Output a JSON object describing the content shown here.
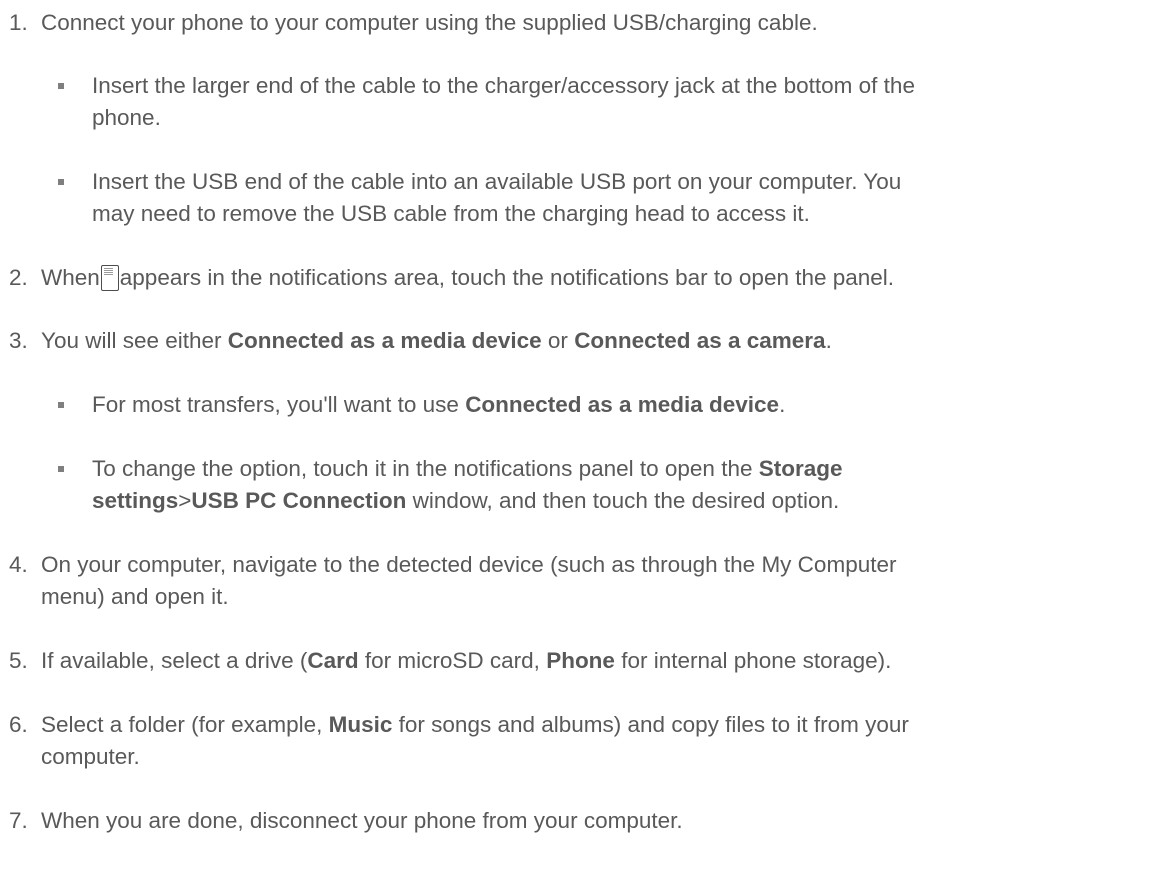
{
  "steps": [
    {
      "num": "1.",
      "text": "Connect your phone to your computer using the supplied USB/charging cable.",
      "subs": [
        {
          "line1": "Insert the larger end of the cable to the charger/accessory jack at the bottom of the",
          "line2": "phone."
        },
        {
          "line1": "Insert the USB end of the cable into an available USB port on your computer. You",
          "line2": "may need to remove the USB cable from the charging head to access it."
        }
      ]
    },
    {
      "num": "2.",
      "pre": "When",
      "icon": "usb-notification-icon",
      "post": "appears in the notifications area, touch the notifications bar to open the panel."
    },
    {
      "num": "3.",
      "a": "You will see either ",
      "b1": "Connected as a media device",
      "c": " or ",
      "b2": "Connected as a camera",
      "d": ".",
      "subs": [
        {
          "a": "For most transfers, you'll want to use ",
          "b": "Connected as a media device",
          "c": "."
        },
        {
          "a": "To change the option, touch it in the notifications panel to open the ",
          "b": "Storage",
          "b2": "settings",
          "sep": ">",
          "b3": "USB PC Connection",
          "c": " window, and then touch the desired option."
        }
      ]
    },
    {
      "num": "4.",
      "line1": "On your computer, navigate to the detected device (such as through the My Computer",
      "line2": "menu) and open it."
    },
    {
      "num": "5.",
      "a": "If available, select a drive (",
      "b1": "Card",
      "c": " for microSD card, ",
      "b2": "Phone",
      "d": " for internal phone storage)."
    },
    {
      "num": "6.",
      "a": "Select a folder (for example, ",
      "b": "Music",
      "c": " for songs and albums) and copy files to it from your",
      "line2": "computer."
    },
    {
      "num": "7.",
      "text": "When you are done, disconnect your phone from your computer."
    }
  ]
}
